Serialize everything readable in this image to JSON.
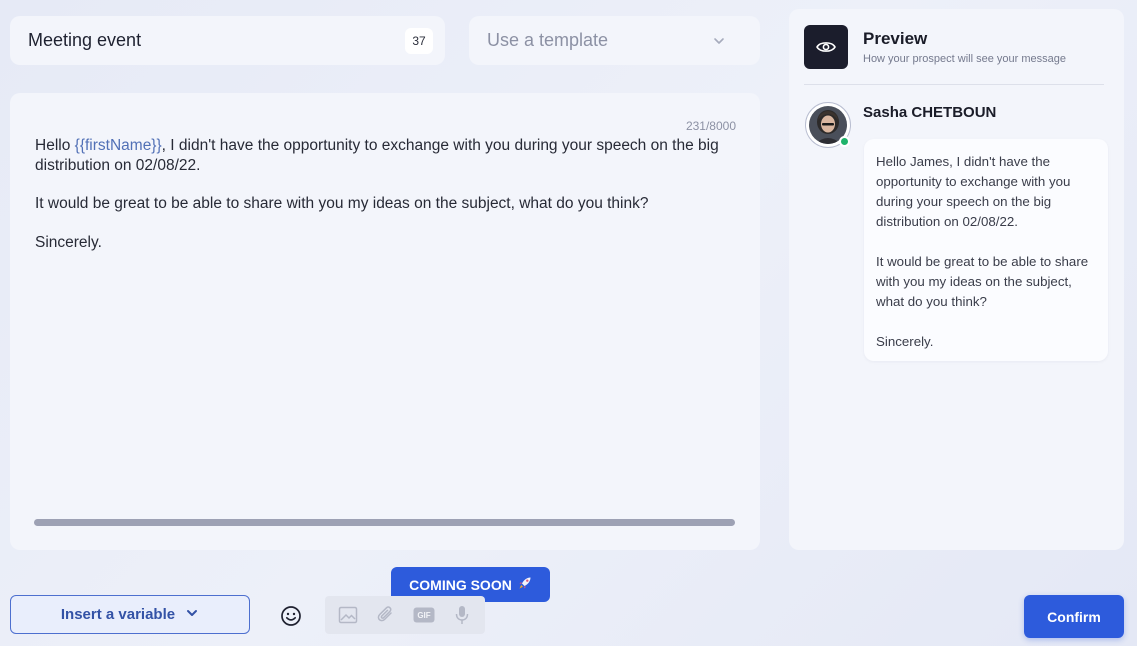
{
  "title_field": {
    "value": "Meeting event",
    "char_count": "37"
  },
  "template_select": {
    "placeholder": "Use a template",
    "icon": "chevron-down-icon"
  },
  "editor": {
    "counter": "231/8000",
    "line1_pre": "Hello ",
    "line1_var": "{{firstName}}",
    "line1_post": ", I didn't have the opportunity to exchange with you during your speech on the big distribution on 02/08/22.",
    "para2": "It would be great to be able to share with you my ideas on the subject, what do you think?",
    "para3": "Sincerely."
  },
  "preview": {
    "icon": "eye-icon",
    "title": "Preview",
    "subtitle": "How your prospect will see your message",
    "sender": "Sasha CHETBOUN",
    "bubble": {
      "para1": "Hello James, I didn't have the opportunity to exchange with you during your speech on the big distribution on 02/08/22.",
      "para2": "It would be great to be able to share with you my ideas on the subject, what do you think?",
      "para3": "Sincerely."
    }
  },
  "toolbar": {
    "coming_soon": "COMING SOON",
    "insert_variable": "Insert a variable",
    "confirm": "Confirm",
    "gif_label": "GIF",
    "icons": [
      "smiley-icon",
      "image-icon",
      "paperclip-icon",
      "gif-icon",
      "microphone-icon",
      "rocket-icon"
    ]
  },
  "colors": {
    "accent": "#2d5bdc",
    "variable": "#5170b6",
    "online": "#1fb36b",
    "preview_icon_bg": "#1b1d2c"
  }
}
